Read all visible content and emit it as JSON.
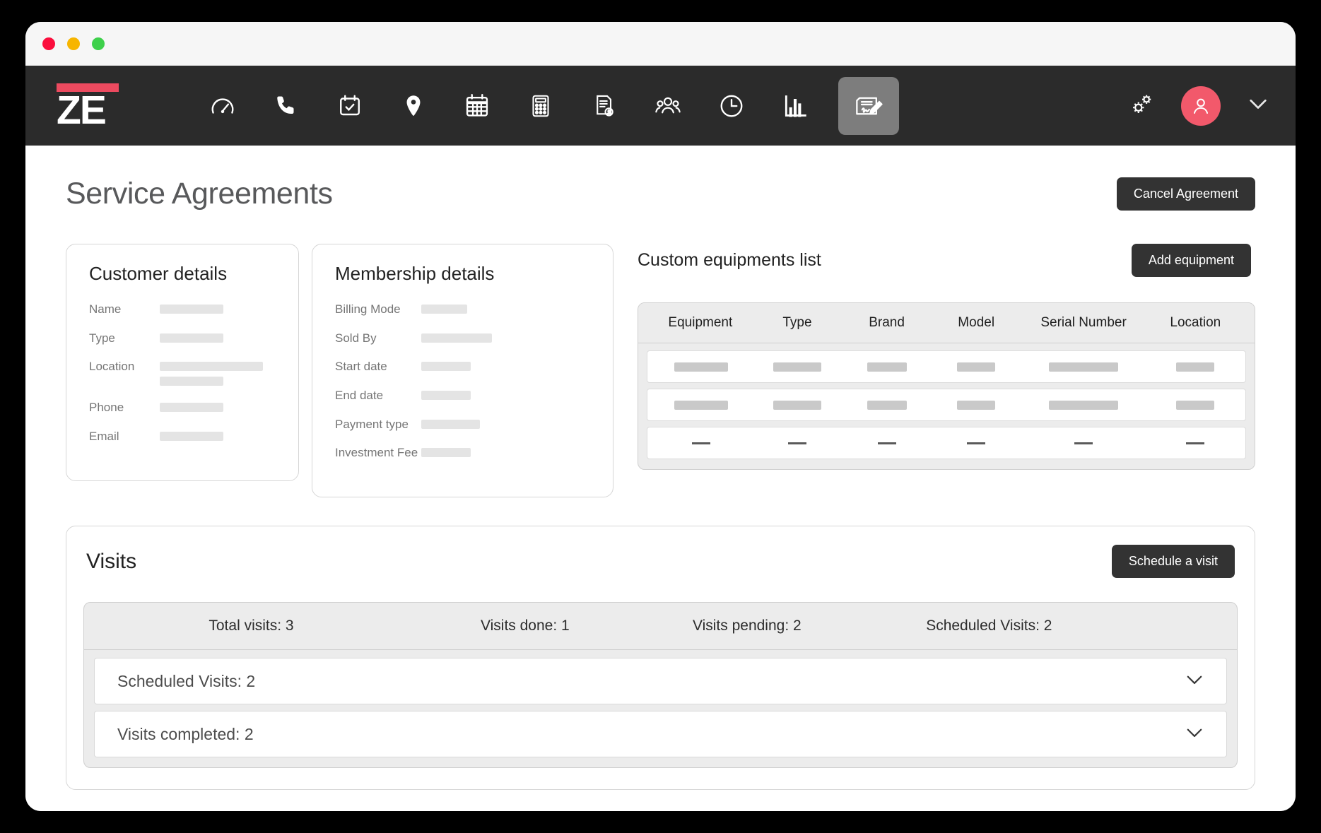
{
  "window": {
    "traffic_lights": [
      "close",
      "minimize",
      "maximize"
    ]
  },
  "navbar": {
    "logo_text": "ZE",
    "logo_bar_color": "#ec4a5f",
    "background_color": "#2b2b2b",
    "active_item_background": "#7d7d7d",
    "items": [
      {
        "icon": "gauge-icon",
        "label": "Dashboard",
        "active": false
      },
      {
        "icon": "phone-icon",
        "label": "Calls",
        "active": false
      },
      {
        "icon": "calendar-check-icon",
        "label": "Appointments",
        "active": false
      },
      {
        "icon": "map-pin-icon",
        "label": "Locations",
        "active": false
      },
      {
        "icon": "calendar-grid-icon",
        "label": "Schedule",
        "active": false
      },
      {
        "icon": "calculator-icon",
        "label": "Estimates",
        "active": false
      },
      {
        "icon": "invoice-dollar-icon",
        "label": "Invoices",
        "active": false
      },
      {
        "icon": "users-icon",
        "label": "Customers",
        "active": false
      },
      {
        "icon": "clock-icon",
        "label": "Time Tracking",
        "active": false
      },
      {
        "icon": "bar-chart-icon",
        "label": "Reports",
        "active": false
      },
      {
        "icon": "signed-contract-icon",
        "label": "Service Agreements",
        "active": true
      }
    ],
    "right": {
      "settings_icon": "gears-icon",
      "avatar_icon": "user-avatar-icon",
      "avatar_color": "#f2596b",
      "chevron_icon": "chevron-down-icon"
    }
  },
  "page": {
    "title": "Service Agreements",
    "cancel_button": "Cancel Agreement"
  },
  "customer_details": {
    "title": "Customer details",
    "fields": [
      {
        "label": "Name",
        "skeletons": [
          90
        ]
      },
      {
        "label": "Type",
        "skeletons": [
          90
        ]
      },
      {
        "label": "Location",
        "skeletons": [
          146,
          90
        ]
      },
      {
        "label": "Phone",
        "skeletons": [
          90
        ]
      },
      {
        "label": "Email",
        "skeletons": [
          90
        ]
      }
    ]
  },
  "membership_details": {
    "title": "Membership details",
    "fields": [
      {
        "label": "Billing Mode",
        "skeletons": [
          65
        ]
      },
      {
        "label": "Sold By",
        "skeletons": [
          100
        ]
      },
      {
        "label": "Start date",
        "skeletons": [
          70
        ]
      },
      {
        "label": "End date",
        "skeletons": [
          70
        ]
      },
      {
        "label": "Payment type",
        "skeletons": [
          83
        ]
      },
      {
        "label": "Investment Fee",
        "skeletons": [
          70
        ]
      }
    ]
  },
  "equipment": {
    "title": "Custom equipments list",
    "add_button": "Add equipment",
    "columns": [
      "Equipment",
      "Type",
      "Brand",
      "Model",
      "Serial Number",
      "Location"
    ],
    "rows": [
      {
        "type": "skeleton",
        "widths": [
          76,
          68,
          56,
          54,
          98,
          54
        ]
      },
      {
        "type": "skeleton",
        "widths": [
          76,
          68,
          56,
          54,
          98,
          54
        ]
      },
      {
        "type": "dash",
        "widths": [
          26,
          26,
          26,
          26,
          26,
          26
        ]
      }
    ]
  },
  "visits": {
    "title": "Visits",
    "schedule_button": "Schedule a visit",
    "summary": [
      "Total visits: 3",
      "Visits done: 1",
      "Visits pending: 2",
      "Scheduled Visits: 2"
    ],
    "accordions": [
      {
        "label": "Scheduled Visits: 2",
        "chevron": "chevron-down-icon"
      },
      {
        "label": "Visits completed: 2",
        "chevron": "chevron-down-icon"
      }
    ]
  }
}
